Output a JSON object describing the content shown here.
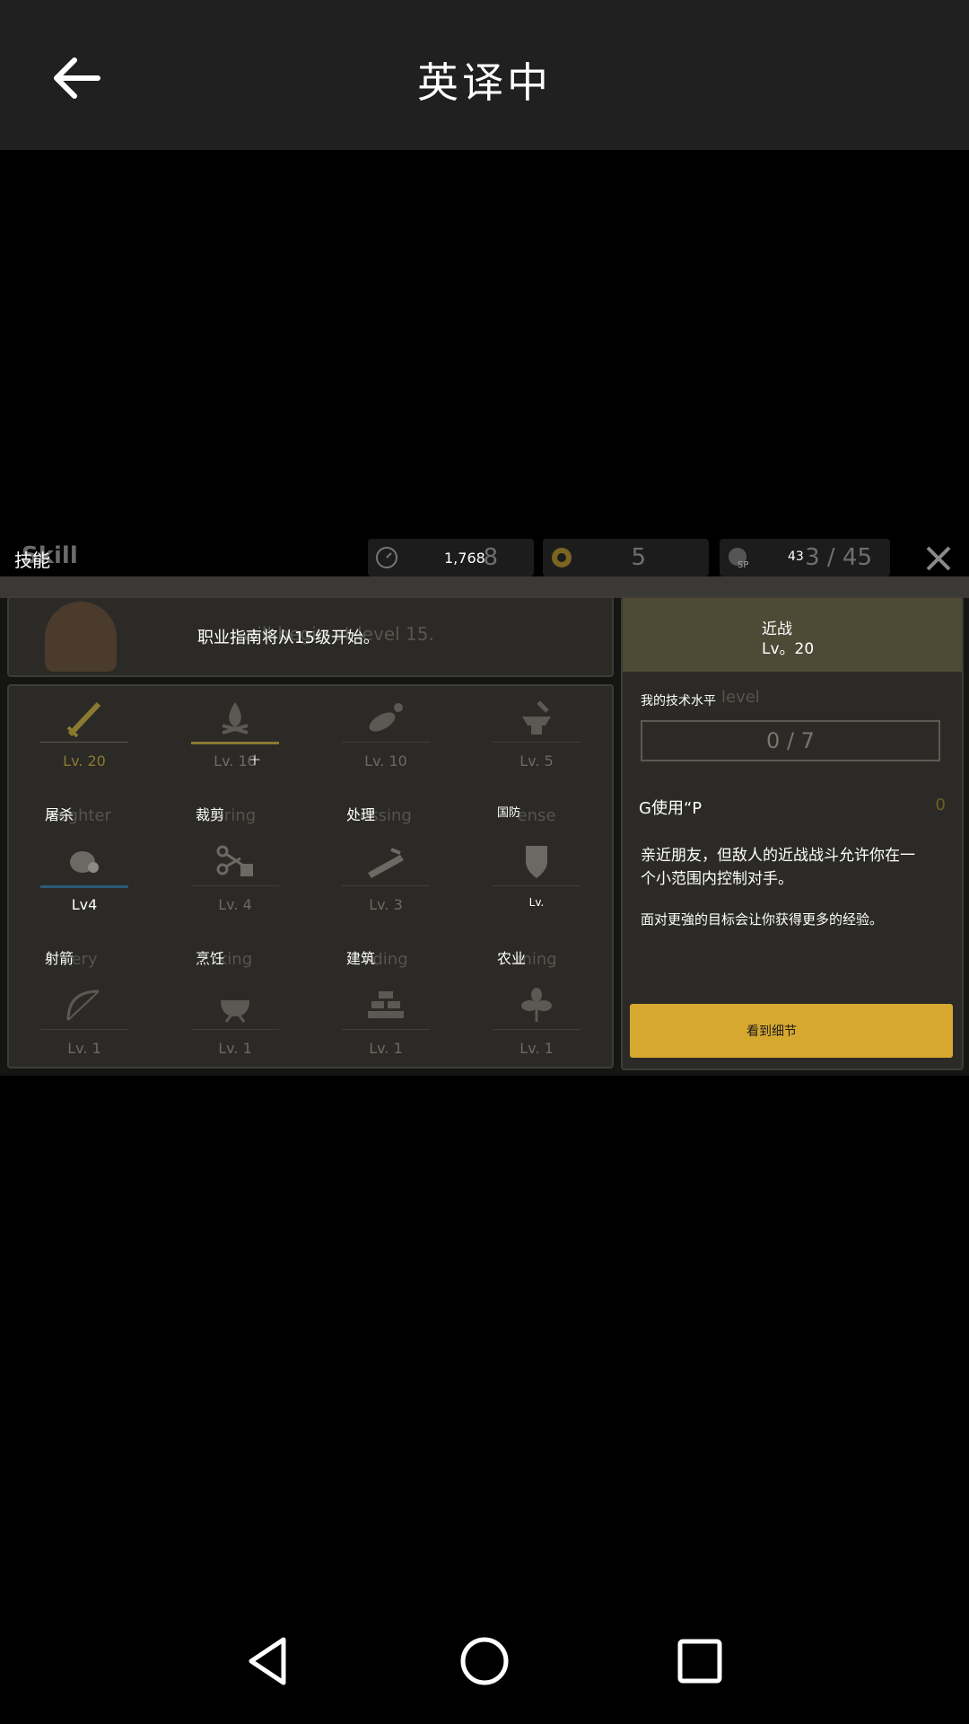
{
  "appbar": {
    "title": "英译中"
  },
  "game": {
    "screen_title": "技能",
    "screen_title_ghost": "Skill",
    "resources": [
      {
        "icon": "clock-icon",
        "label": "1,768",
        "ghost": "8"
      },
      {
        "icon": "gear-coin-icon",
        "label": "",
        "ghost": "5"
      },
      {
        "icon": "sp-icon",
        "label": "43",
        "ghost": "3 / 45"
      }
    ],
    "banner": {
      "message": "职业指南将从15级开始。",
      "ghost": "will begin at level 15."
    },
    "skills": [
      {
        "name": "",
        "ghost": "",
        "level": "Lv. 20",
        "icon": "sword-icon"
      },
      {
        "name": "",
        "ghost": "",
        "level": "Lv. 10",
        "level_overlay": "十",
        "icon": "campfire-icon"
      },
      {
        "name": "",
        "ghost": "",
        "level": "Lv. 10",
        "icon": "herb-icon"
      },
      {
        "name": "",
        "ghost": "",
        "level": "Lv. 5",
        "icon": "anvil-icon"
      },
      {
        "name": "屠杀",
        "ghost": "ughter",
        "level": "Lv4",
        "icon": "meat-icon"
      },
      {
        "name": "裁剪",
        "ghost": "oring",
        "level": "Lv. 4",
        "icon": "scissors-icon"
      },
      {
        "name": "处理",
        "ghost": "essing",
        "level": "Lv. 3",
        "icon": "plank-icon"
      },
      {
        "name": "国防",
        "ghost": "ense",
        "level": "Lv.",
        "icon": "shield-icon"
      },
      {
        "name": "射箭",
        "ghost": "ery",
        "level": "Lv. 1",
        "icon": "bow-icon"
      },
      {
        "name": "烹饪",
        "ghost": "king",
        "level": "Lv. 1",
        "icon": "pot-icon"
      },
      {
        "name": "建筑",
        "ghost": "ilding",
        "level": "Lv. 1",
        "icon": "bricks-icon"
      },
      {
        "name": "农业",
        "ghost": "ming",
        "level": "Lv. 1",
        "icon": "plant-icon"
      }
    ],
    "side": {
      "skill_name": "近战",
      "skill_level": "Lv。20",
      "my_level_label": "我的技术水平",
      "my_level_ghost": "level",
      "my_level_value": "0 / 7",
      "use_sp": "G使用“P",
      "use_sp_value": "0",
      "desc1": "亲近朋友，但敌人的近战战斗允许你在一个小范围内控制对手。",
      "desc2": "面对更強的目标会让你获得更多的经验。",
      "button": "看到细节"
    }
  }
}
